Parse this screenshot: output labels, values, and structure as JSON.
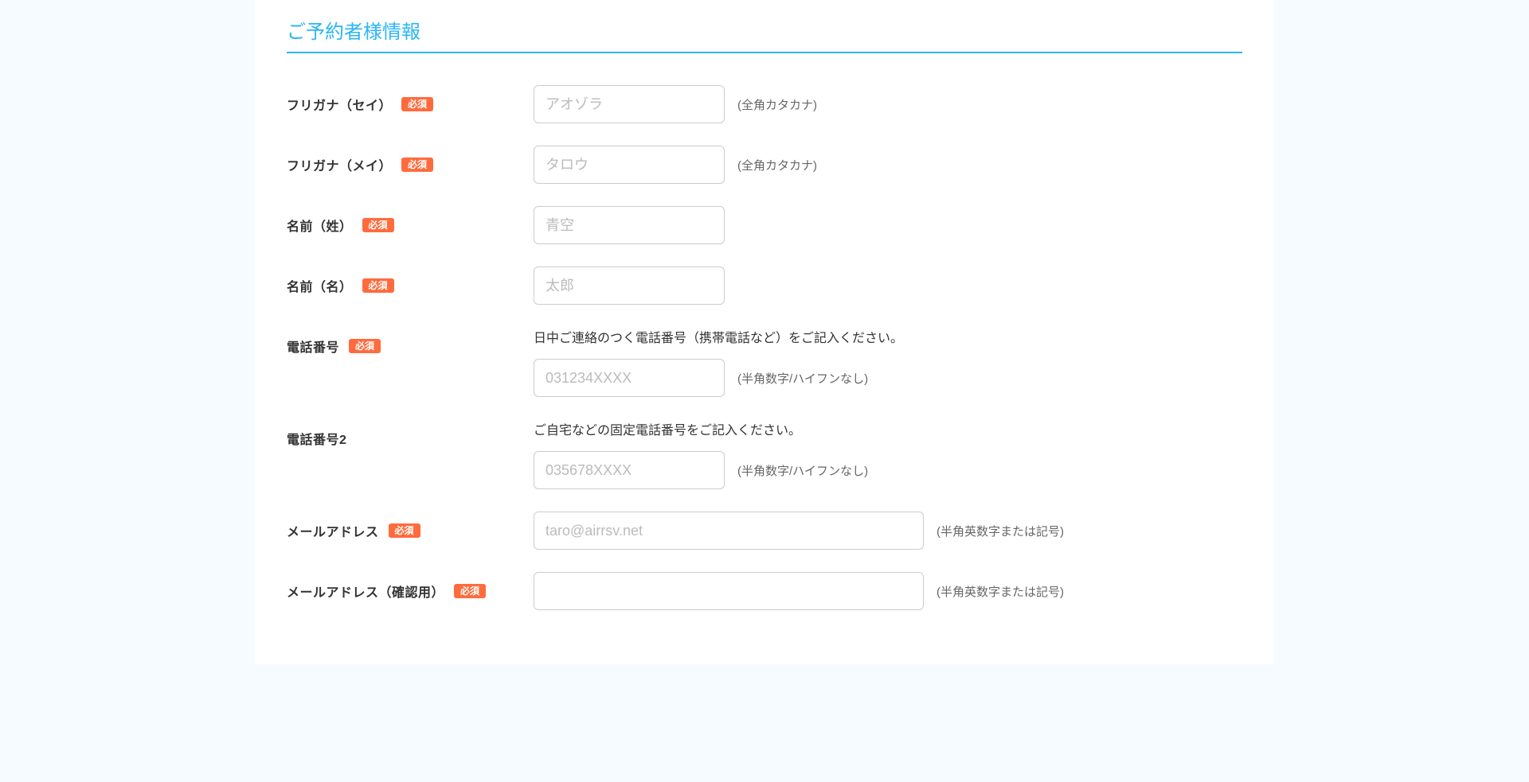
{
  "section_title": "ご予約者様情報",
  "required_label": "必須",
  "fields": {
    "furigana_sei": {
      "label": "フリガナ（セイ）",
      "placeholder": "アオゾラ",
      "hint": "(全角カタカナ)"
    },
    "furigana_mei": {
      "label": "フリガナ（メイ）",
      "placeholder": "タロウ",
      "hint": "(全角カタカナ)"
    },
    "name_sei": {
      "label": "名前（姓）",
      "placeholder": "青空"
    },
    "name_mei": {
      "label": "名前（名）",
      "placeholder": "太郎"
    },
    "phone1": {
      "label": "電話番号",
      "help": "日中ご連絡のつく電話番号（携帯電話など）をご記入ください。",
      "placeholder": "031234XXXX",
      "hint": "(半角数字/ハイフンなし)"
    },
    "phone2": {
      "label": "電話番号2",
      "help": "ご自宅などの固定電話番号をご記入ください。",
      "placeholder": "035678XXXX",
      "hint": "(半角数字/ハイフンなし)"
    },
    "email": {
      "label": "メールアドレス",
      "placeholder": "taro@airrsv.net",
      "hint": "(半角英数字または記号)"
    },
    "email_confirm": {
      "label": "メールアドレス（確認用）",
      "placeholder": "",
      "hint": "(半角英数字または記号)"
    }
  }
}
